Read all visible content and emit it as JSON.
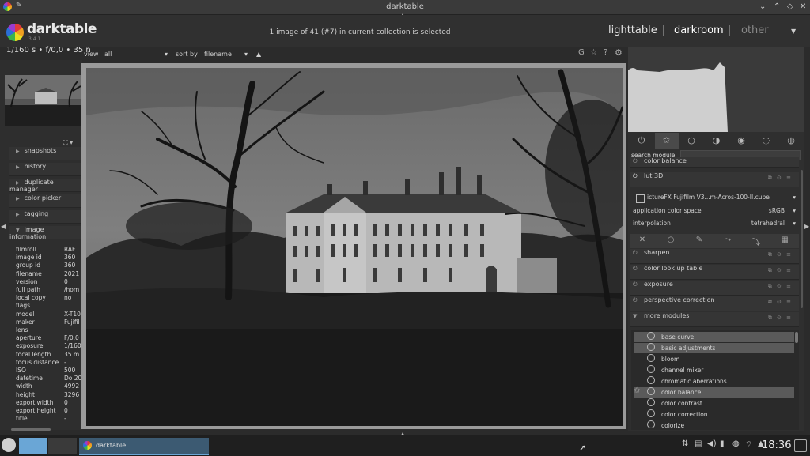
{
  "window": {
    "title": "darktable",
    "controls": [
      "⌄",
      "⌃",
      "◇",
      "✕"
    ]
  },
  "header": {
    "logo": "darktable",
    "version": "3.4.1",
    "collection_status": "1 image of 41 (#7) in current collection is selected",
    "views": {
      "lighttable": "lighttable",
      "sep1": "|",
      "darkroom": "darkroom",
      "sep2": "|",
      "other": "other",
      "dropdown": "▼"
    }
  },
  "exif_line": "1/160 s • f/0,0 • 35 n",
  "filterbar": {
    "view_label": "view",
    "view_value": "all",
    "sort_label": "sort by",
    "sort_value": "filename",
    "dropdown": "▾",
    "sort_dir": "▲"
  },
  "toolbar_icons": [
    "G",
    "☆",
    "?",
    "⚙"
  ],
  "left_sections": [
    {
      "label": "snapshots"
    },
    {
      "label": "history"
    },
    {
      "label": "duplicate manager"
    },
    {
      "label": "color picker"
    },
    {
      "label": "tagging"
    },
    {
      "label": "image information"
    }
  ],
  "image_info": [
    {
      "k": "filmroll",
      "v": "RAF"
    },
    {
      "k": "image id",
      "v": "360"
    },
    {
      "k": "group id",
      "v": "360"
    },
    {
      "k": "filename",
      "v": "2021"
    },
    {
      "k": "version",
      "v": "0"
    },
    {
      "k": "full path",
      "v": "/hom"
    },
    {
      "k": "local copy",
      "v": "no"
    },
    {
      "k": "flags",
      "v": "1..."
    },
    {
      "k": "model",
      "v": "X-T10"
    },
    {
      "k": "maker",
      "v": "Fujifil"
    },
    {
      "k": "lens",
      "v": ""
    },
    {
      "k": "aperture",
      "v": "F/0,0"
    },
    {
      "k": "exposure",
      "v": "1/160"
    },
    {
      "k": "focal length",
      "v": "35 m"
    },
    {
      "k": "focus distance",
      "v": "-"
    },
    {
      "k": "ISO",
      "v": "500"
    },
    {
      "k": "datetime",
      "v": "Do 20"
    },
    {
      "k": "width",
      "v": "4992"
    },
    {
      "k": "height",
      "v": "3296"
    },
    {
      "k": "export width",
      "v": "0"
    },
    {
      "k": "export height",
      "v": "0"
    },
    {
      "k": "title",
      "v": "-"
    }
  ],
  "right": {
    "search_label": "search module",
    "group_tabs": [
      "⏻",
      "✩",
      "○",
      "◑",
      "◉",
      "◌",
      "◍"
    ],
    "modules_top": [
      {
        "label": "color balance"
      },
      {
        "label": "lut 3D"
      }
    ],
    "lut3d_props": [
      {
        "k": "",
        "v": "ictureFX Fujifilm V3...m-Acros-100-II.cube"
      },
      {
        "k": "application color space",
        "v": "sRGB"
      },
      {
        "k": "interpolation",
        "v": "tetrahedral"
      }
    ],
    "blend_tabs": [
      "✕",
      "○",
      "✎",
      "⤳",
      "⤵",
      "▦"
    ],
    "modules_mid": [
      {
        "label": "sharpen"
      },
      {
        "label": "color look up table"
      },
      {
        "label": "exposure"
      },
      {
        "label": "perspective correction"
      },
      {
        "label": "more modules"
      }
    ],
    "more_modules": [
      {
        "label": "base curve",
        "selected": true
      },
      {
        "label": "basic adjustments",
        "selected": true
      },
      {
        "label": "bloom",
        "selected": false
      },
      {
        "label": "channel mixer",
        "selected": false
      },
      {
        "label": "chromatic aberrations",
        "selected": false
      },
      {
        "label": "color balance",
        "selected": true
      },
      {
        "label": "color contrast",
        "selected": false
      },
      {
        "label": "color correction",
        "selected": false
      },
      {
        "label": "colorize",
        "selected": false
      }
    ],
    "module_controls": "⧉ ⊙ ≡"
  },
  "taskbar": {
    "app_label": "darktable",
    "clock": "18:36",
    "tray": [
      "⇅",
      "▤",
      "◀)",
      "▮",
      "◍",
      "⌔",
      "▲"
    ]
  },
  "colors": {
    "accent_blue": "#6aa6d6",
    "panel": "#2f2f2f",
    "selected": "#5a5a5a"
  }
}
